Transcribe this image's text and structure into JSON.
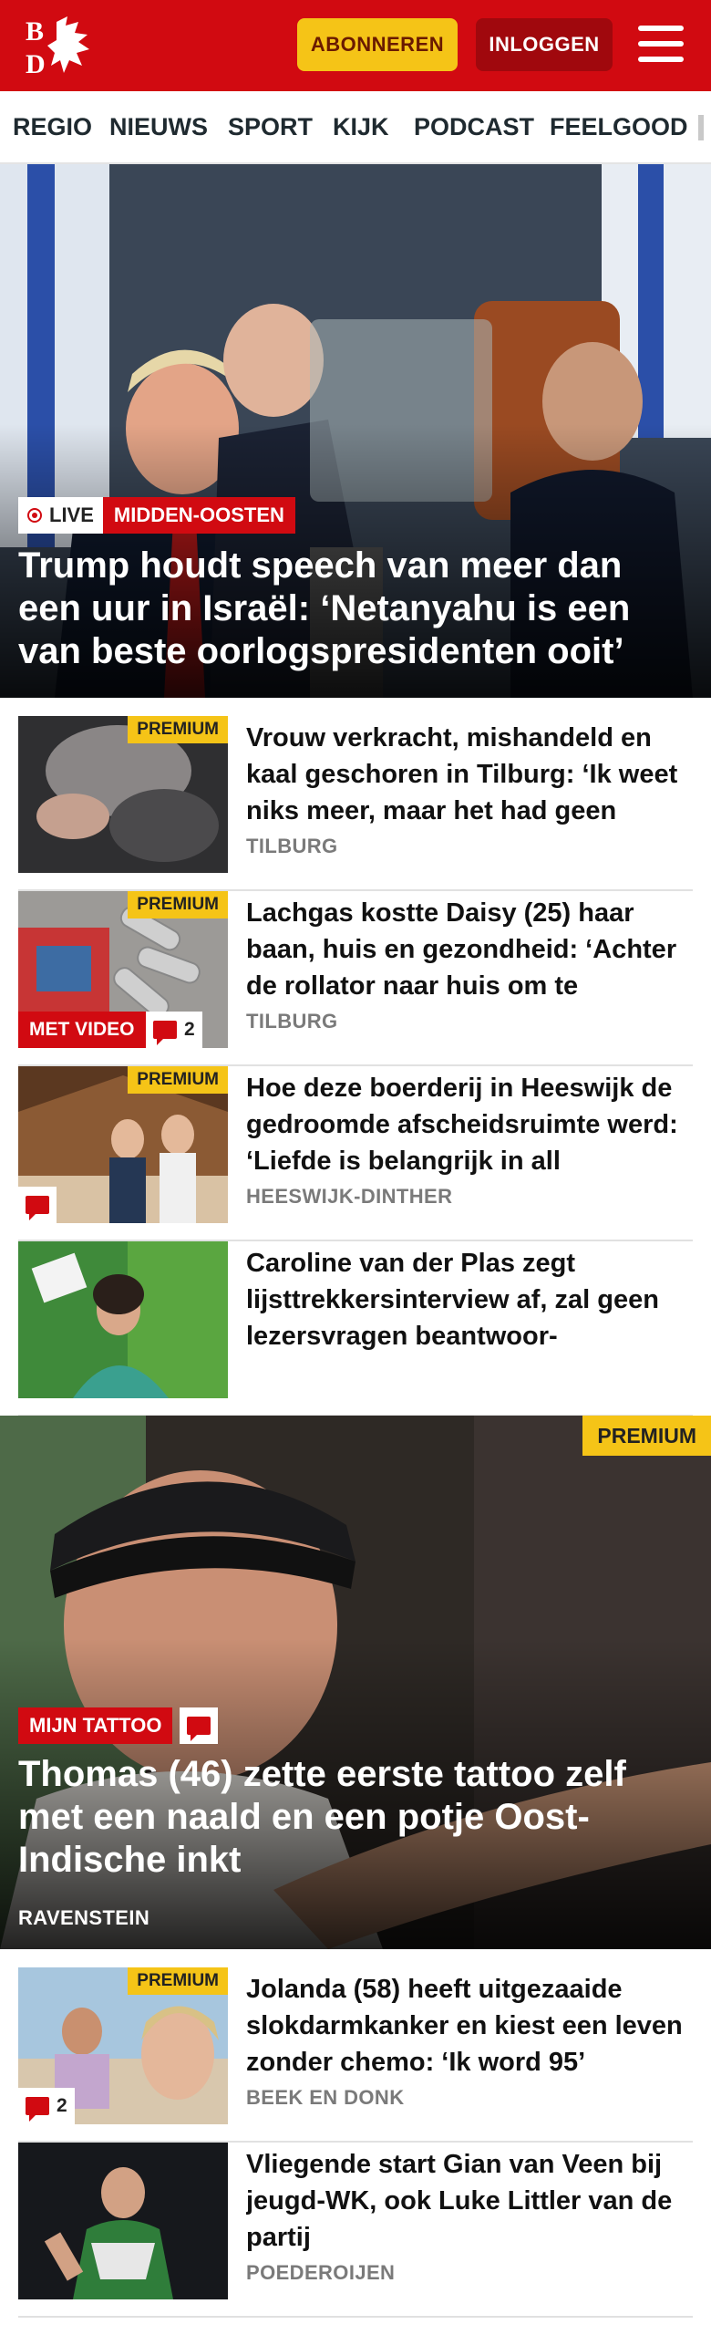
{
  "header": {
    "logo_text": "BD",
    "subscribe_label": "ABONNEREN",
    "login_label": "INLOGGEN",
    "menu_icon": "hamburger-menu-icon",
    "brand_color": "#d10a11",
    "accent_color": "#f5c417"
  },
  "nav": {
    "items": [
      "REGIO",
      "NIEUWS",
      "SPORT",
      "KIJK",
      "PODCAST",
      "FEELGOOD"
    ]
  },
  "hero": {
    "live_label": "LIVE",
    "category": "MIDDEN-OOSTEN",
    "title": "Trump houdt speech van meer dan een uur in Israël: ‘Netanyahu is een van beste oorlogspresidenten ooit’"
  },
  "articles": [
    {
      "premium": "PREMIUM",
      "title": "Vrouw verkracht, mishandeld en kaal geschoren in Tilburg: ‘Ik weet niks meer, maar het had geen",
      "location": "TILBURG"
    },
    {
      "premium": "PREMIUM",
      "title": "Lachgas kostte Daisy (25) haar baan, huis en gezondheid: ‘Achter de rollator naar huis om te",
      "location": "TILBURG",
      "video_label": "MET VIDEO",
      "comments": "2"
    },
    {
      "premium": "PREMIUM",
      "title": "Hoe deze boerderij in Heeswijk de gedroomde afscheidsruimte werd: ‘Liefde is belangrijk in all",
      "location": "HEESWIJK-DINTHER"
    },
    {
      "title": "Caroline van der Plas zegt lijsttrekkersinterview af, zal geen lezersvragen beantwoor-"
    }
  ],
  "feature": {
    "premium": "PREMIUM",
    "category": "MIJN TATTOO",
    "title": "Thomas (46) zette eerste tattoo zelf met een naald en een potje Oost-Indische inkt",
    "location": "RAVENSTEIN"
  },
  "articles_bottom": [
    {
      "premium": "PREMIUM",
      "title": "Jolanda (58) heeft uitgezaaide slokdarmkanker en kiest een leven zonder chemo: ‘Ik word 95’",
      "location": "BEEK EN DONK",
      "comments": "2"
    },
    {
      "title": "Vliegende start Gian van Veen bij jeugd-WK, ook Luke Littler van de partij",
      "location": "POEDEROIJEN"
    }
  ]
}
